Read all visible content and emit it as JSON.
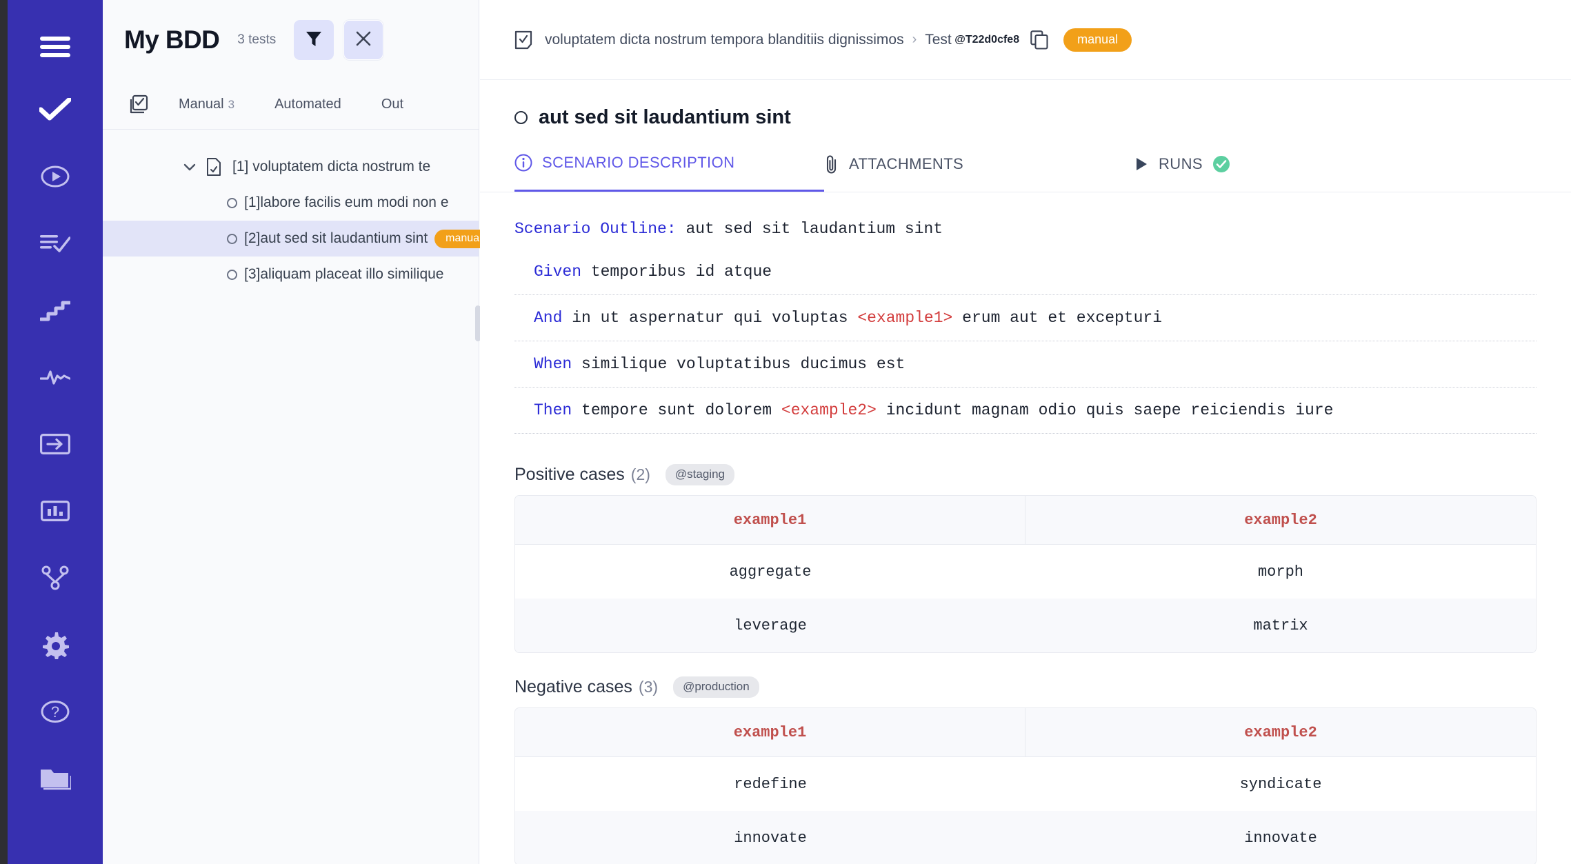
{
  "nav": {
    "items": [
      {
        "name": "menu-icon",
        "label": "Menu"
      },
      {
        "name": "tests-check-icon",
        "label": "Tests"
      },
      {
        "name": "play-circle-icon",
        "label": "Runs"
      },
      {
        "name": "list-check-icon",
        "label": "Test Plans"
      },
      {
        "name": "stairs-icon",
        "label": "Steps"
      },
      {
        "name": "pulse-icon",
        "label": "Activity"
      },
      {
        "name": "import-arrow-icon",
        "label": "Import"
      },
      {
        "name": "bar-chart-icon",
        "label": "Reports"
      },
      {
        "name": "branch-icon",
        "label": "Integrations"
      },
      {
        "name": "gear-icon",
        "label": "Settings"
      },
      {
        "name": "help-circle-icon",
        "label": "Help"
      },
      {
        "name": "folder-icon",
        "label": "Projects"
      }
    ]
  },
  "tree": {
    "title": "My BDD",
    "test_count": "3 tests",
    "filter_label": "Filter",
    "close_label": "Close",
    "tabs": [
      {
        "label": "Manual",
        "count": "3"
      },
      {
        "label": "Automated",
        "count": ""
      },
      {
        "label": "Out",
        "count": ""
      }
    ],
    "rows": [
      {
        "kind": "root",
        "index": "[1]",
        "label": "voluptatem dicta nostrum te",
        "badge": "",
        "selected": false
      },
      {
        "kind": "child",
        "index": "[1]",
        "label": "labore facilis eum modi non e",
        "badge": "",
        "selected": false
      },
      {
        "kind": "child",
        "index": "[2]",
        "label": "aut sed sit laudantium sint",
        "badge": "manual",
        "selected": true
      },
      {
        "kind": "child",
        "index": "[3]",
        "label": "aliquam placeat illo similique",
        "badge": "",
        "selected": false
      }
    ]
  },
  "detail": {
    "breadcrumb": {
      "suite": "voluptatem dicta nostrum tempora blanditiis dignissimos",
      "separator": "›",
      "test_word": "Test",
      "test_id": "@T22d0cfe8",
      "badge": "manual"
    },
    "title": "aut sed sit laudantium sint",
    "tabs": [
      {
        "label": "SCENARIO DESCRIPTION",
        "active": true
      },
      {
        "label": "ATTACHMENTS",
        "active": false
      },
      {
        "label": "RUNS",
        "active": false
      }
    ],
    "gherkin": {
      "outline_keyword": "Scenario Outline:",
      "outline_name": "aut sed sit laudantium sint",
      "steps": [
        {
          "keyword": "Given",
          "pre": "temporibus id atque",
          "param": "",
          "post": ""
        },
        {
          "keyword": "And",
          "pre": "in ut aspernatur qui voluptas",
          "param": "<example1>",
          "post": "erum aut et excepturi"
        },
        {
          "keyword": "When",
          "pre": "similique voluptatibus ducimus est",
          "param": "",
          "post": ""
        },
        {
          "keyword": "Then",
          "pre": "tempore sunt dolorem",
          "param": "<example2>",
          "post": "incidunt magnam odio quis saepe reiciendis iure"
        }
      ]
    },
    "examples": [
      {
        "title": "Positive cases",
        "count": "(2)",
        "tag": "@staging",
        "columns": [
          "example1",
          "example2"
        ],
        "rows": [
          [
            "aggregate",
            "morph"
          ],
          [
            "leverage",
            "matrix"
          ]
        ]
      },
      {
        "title": "Negative cases",
        "count": "(3)",
        "tag": "@production",
        "columns": [
          "example1",
          "example2"
        ],
        "rows": [
          [
            "redefine",
            "syndicate"
          ],
          [
            "innovate",
            "innovate"
          ]
        ]
      }
    ]
  },
  "colors": {
    "nav_bg": "#3730b0",
    "accent": "#6058e8",
    "badge_orange": "#f2a019",
    "param_red": "#d33d3d",
    "keyword_blue": "#2b2bd6",
    "status_green": "#5ccfa0",
    "selected_row": "#e2e4f8"
  }
}
